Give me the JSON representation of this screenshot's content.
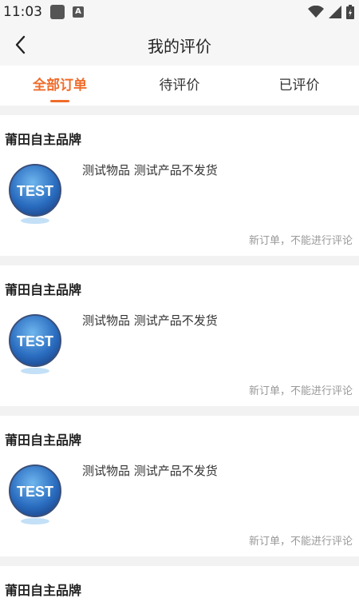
{
  "status_bar": {
    "time": "11:03"
  },
  "header": {
    "title": "我的评价"
  },
  "tabs": [
    {
      "label": "全部订单",
      "active": true
    },
    {
      "label": "待评价",
      "active": false
    },
    {
      "label": "已评价",
      "active": false
    }
  ],
  "orders": [
    {
      "shop": "莆田自主品牌",
      "product": "测试物品 测试产品不发货",
      "status": "新订单，不能进行评论",
      "thumb_text": "TEST"
    },
    {
      "shop": "莆田自主品牌",
      "product": "测试物品 测试产品不发货",
      "status": "新订单，不能进行评论",
      "thumb_text": "TEST"
    },
    {
      "shop": "莆田自主品牌",
      "product": "测试物品 测试产品不发货",
      "status": "新订单，不能进行评论",
      "thumb_text": "TEST"
    },
    {
      "shop": "莆田自主品牌"
    }
  ],
  "colors": {
    "accent": "#ef6c2b",
    "background": "#f2f2f2"
  }
}
